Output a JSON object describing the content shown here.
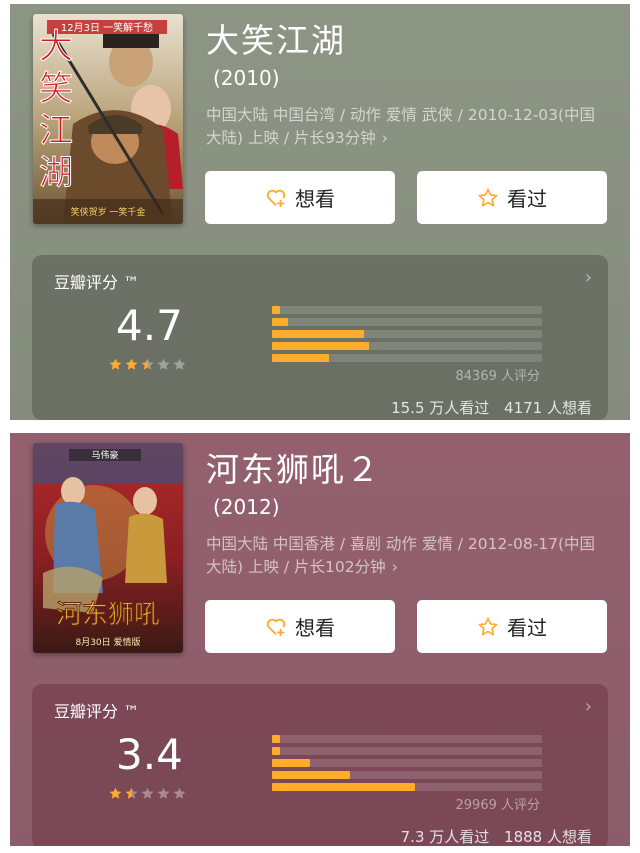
{
  "colors": {
    "accent": "#ffac2d",
    "card1_bg": "#8d9585",
    "card2_bg": "#94606e"
  },
  "movies": [
    {
      "title": "大笑江湖",
      "year": "(2010)",
      "info": "中国大陆 中国台湾 / 动作 爱情 武侠 / 2010-12-03(中国大陆) 上映 / 片长93分钟",
      "buttons": {
        "want": "想看",
        "seen": "看过"
      },
      "rating": {
        "label": "豆瓣评分 ™",
        "score": "4.7",
        "stars": 2.5,
        "distribution": [
          0.02,
          0.06,
          0.34,
          0.36,
          0.21
        ],
        "votes": "84369 人评分",
        "watched": "15.5 万人看过",
        "wish": "4171 人想看"
      },
      "poster": {
        "vertical_text": [
          "大",
          "笑",
          "江",
          "湖"
        ],
        "top_text": "12月3日 一笑解千愁",
        "bottom_text": "笑侠贺岁 一笑千金"
      }
    },
    {
      "title": "河东狮吼２",
      "year": "(2012)",
      "info": "中国大陆 中国香港 / 喜剧 动作 爱情 / 2012-08-17(中国大陆) 上映 / 片长102分钟",
      "buttons": {
        "want": "想看",
        "seen": "看过"
      },
      "rating": {
        "label": "豆瓣评分 ™",
        "score": "3.4",
        "stars": 1.5,
        "distribution": [
          0.03,
          0.03,
          0.14,
          0.29,
          0.53
        ],
        "votes": "29969 人评分",
        "watched": "7.3 万人看过",
        "wish": "1888 人想看"
      },
      "poster": {
        "title_text": "河东狮吼",
        "top_text": "马伟豪",
        "date_text": "8月30日 爱情版"
      }
    }
  ]
}
